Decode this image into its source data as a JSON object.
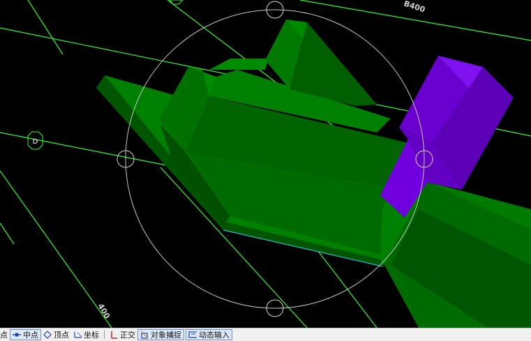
{
  "viewport": {
    "axis_labels": {
      "d_marker": "D",
      "dimension_top": "B400",
      "dimension_bottom": "400"
    },
    "colors": {
      "background": "#000000",
      "grid_line": "#2bff2b",
      "beam_light": "#008000",
      "beam_dark": "#005500",
      "column_top": "#7a00e6",
      "column_front": "#5a00b4",
      "selection_circle": "#c8c8c8",
      "edge_highlight": "#00e5ff"
    }
  },
  "status_bar": {
    "items": [
      {
        "label": "点",
        "icon": "point-icon"
      },
      {
        "label": "中点",
        "icon": "midpoint-icon",
        "pressed": true
      },
      {
        "label": "顶点",
        "icon": "vertex-icon"
      },
      {
        "label": "坐标",
        "icon": "coordinate-icon"
      },
      {
        "label": "正交",
        "icon": "ortho-icon"
      },
      {
        "label": "对象捕捉",
        "icon": "object-snap-icon",
        "pressed": true
      },
      {
        "label": "动态输入",
        "icon": "dynamic-input-icon",
        "pressed": true
      }
    ]
  }
}
